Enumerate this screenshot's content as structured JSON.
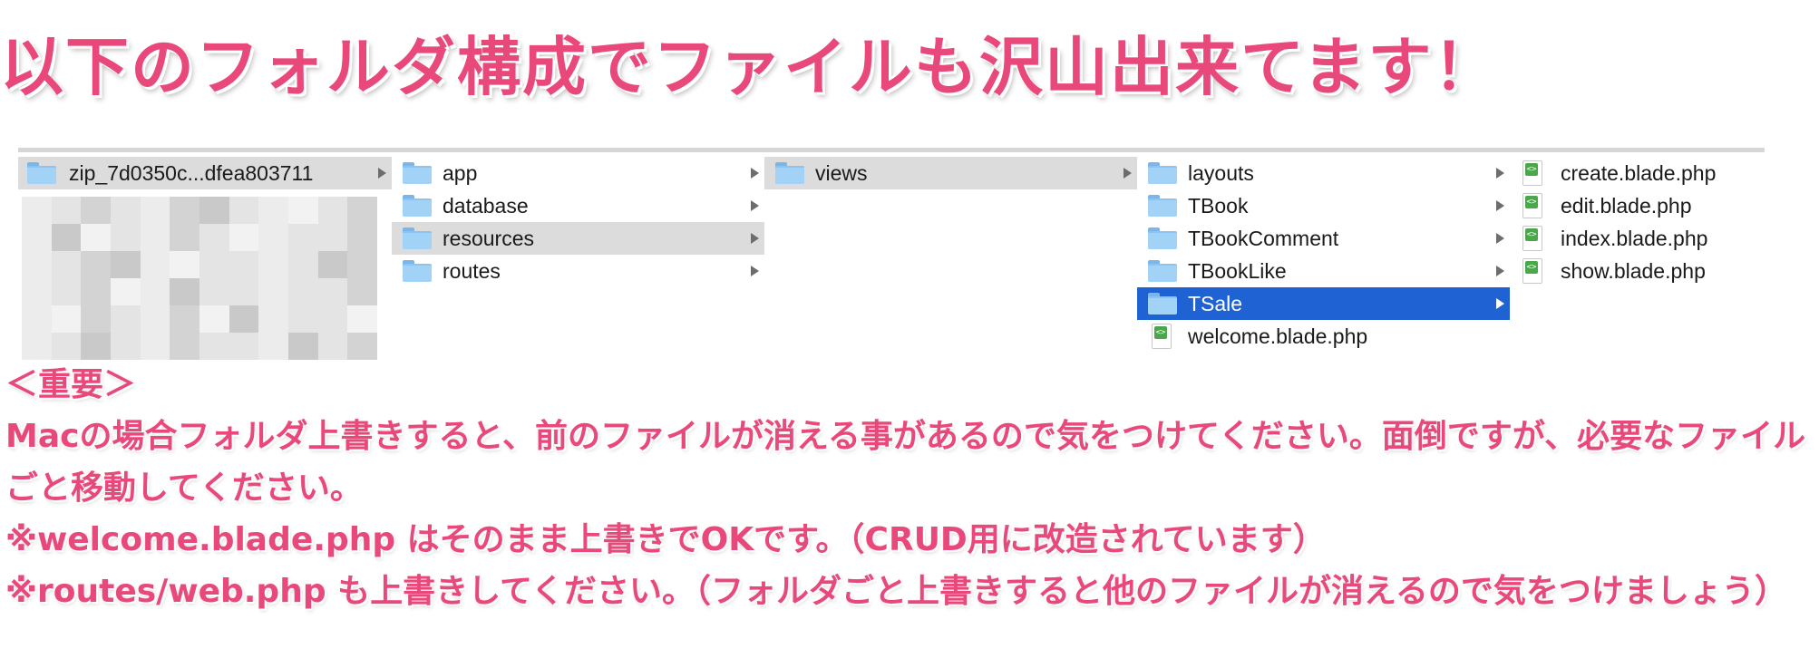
{
  "headline": "以下のフォルダ構成でファイルも沢山出来てます！",
  "finder": {
    "columns": [
      {
        "items": [
          {
            "label": "zip_7d0350c...dfea803711",
            "type": "folder",
            "selected": "gray",
            "arrow": true
          }
        ],
        "blurred_region": true
      },
      {
        "items": [
          {
            "label": "app",
            "type": "folder",
            "arrow": true
          },
          {
            "label": "database",
            "type": "folder",
            "arrow": true
          },
          {
            "label": "resources",
            "type": "folder",
            "selected": "gray",
            "arrow": true
          },
          {
            "label": "routes",
            "type": "folder",
            "arrow": true
          }
        ]
      },
      {
        "items": [
          {
            "label": "views",
            "type": "folder",
            "selected": "gray",
            "arrow": true
          }
        ]
      },
      {
        "items": [
          {
            "label": "layouts",
            "type": "folder",
            "arrow": true
          },
          {
            "label": "TBook",
            "type": "folder",
            "arrow": true
          },
          {
            "label": "TBookComment",
            "type": "folder",
            "arrow": true
          },
          {
            "label": "TBookLike",
            "type": "folder",
            "arrow": true
          },
          {
            "label": "TSale",
            "type": "folder",
            "selected": "blue",
            "arrow": true
          },
          {
            "label": "welcome.blade.php",
            "type": "file"
          }
        ]
      },
      {
        "items": [
          {
            "label": "create.blade.php",
            "type": "file"
          },
          {
            "label": "edit.blade.php",
            "type": "file"
          },
          {
            "label": "index.blade.php",
            "type": "file"
          },
          {
            "label": "show.blade.php",
            "type": "file"
          }
        ]
      }
    ]
  },
  "notes": {
    "heading": "＜重要＞",
    "line1": "Macの場合フォルダ上書きすると、前のファイルが消える事があるので気をつけてください。面倒ですが、必要なファイルごと移動してください。",
    "line2": "※welcome.blade.php はそのまま上書きでOKです。（CRUD用に改造されています）",
    "line3": "※routes/web.php も上書きしてください。（フォルダごと上書きすると他のファイルが消えるので気をつけましょう）"
  },
  "colors": {
    "accent_pink": "#e8497a",
    "selection_blue": "#1f62d4",
    "selection_gray": "#dcdcdc",
    "folder_blue": "#a2d2f6",
    "file_badge_green": "#4aa84a"
  }
}
